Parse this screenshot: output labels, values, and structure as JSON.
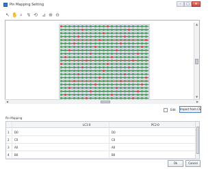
{
  "window": {
    "title": "Pin Mapping Setting",
    "min_glyph": "–",
    "max_glyph": "□",
    "close_glyph": "✕"
  },
  "toolbar": {
    "tools": [
      {
        "name": "select-arrow-icon",
        "glyph": "↖"
      },
      {
        "name": "pan-hand-icon",
        "glyph": "✋"
      },
      {
        "name": "zoom-icon",
        "glyph": "⌕"
      },
      {
        "name": "route-icon",
        "glyph": "↯"
      },
      {
        "name": "rotate-icon",
        "glyph": "⟲"
      },
      {
        "name": "align-icon",
        "glyph": "⊿"
      },
      {
        "name": "zoom-in-icon",
        "glyph": "⊕"
      },
      {
        "name": "zoom-out-icon",
        "glyph": "⊖"
      }
    ]
  },
  "scroll": {
    "up": "▲",
    "down": "▼",
    "left": "◀",
    "right": "▶"
  },
  "controls": {
    "edit_label": "Edit",
    "import_label": "Import from CSV"
  },
  "pin_mapping": {
    "section_label": "Pin Mapping",
    "columns": [
      "LC1:0",
      "PC2:0"
    ],
    "rows": [
      {
        "num": "1",
        "lc": "D0",
        "pc": "D0"
      },
      {
        "num": "2",
        "lc": "C0",
        "pc": "C0"
      },
      {
        "num": "3",
        "lc": "A0",
        "pc": "A0"
      },
      {
        "num": "4",
        "lc": "B0",
        "pc": "B0"
      }
    ]
  },
  "footer": {
    "ok_label": "Ok",
    "cancel_label": "Cancel"
  },
  "colors": {
    "pin_green": "#3aa84a",
    "pin_red": "#d9413d",
    "chip_body": "#d6dbe1",
    "accent_blue": "#4d7fbd"
  }
}
